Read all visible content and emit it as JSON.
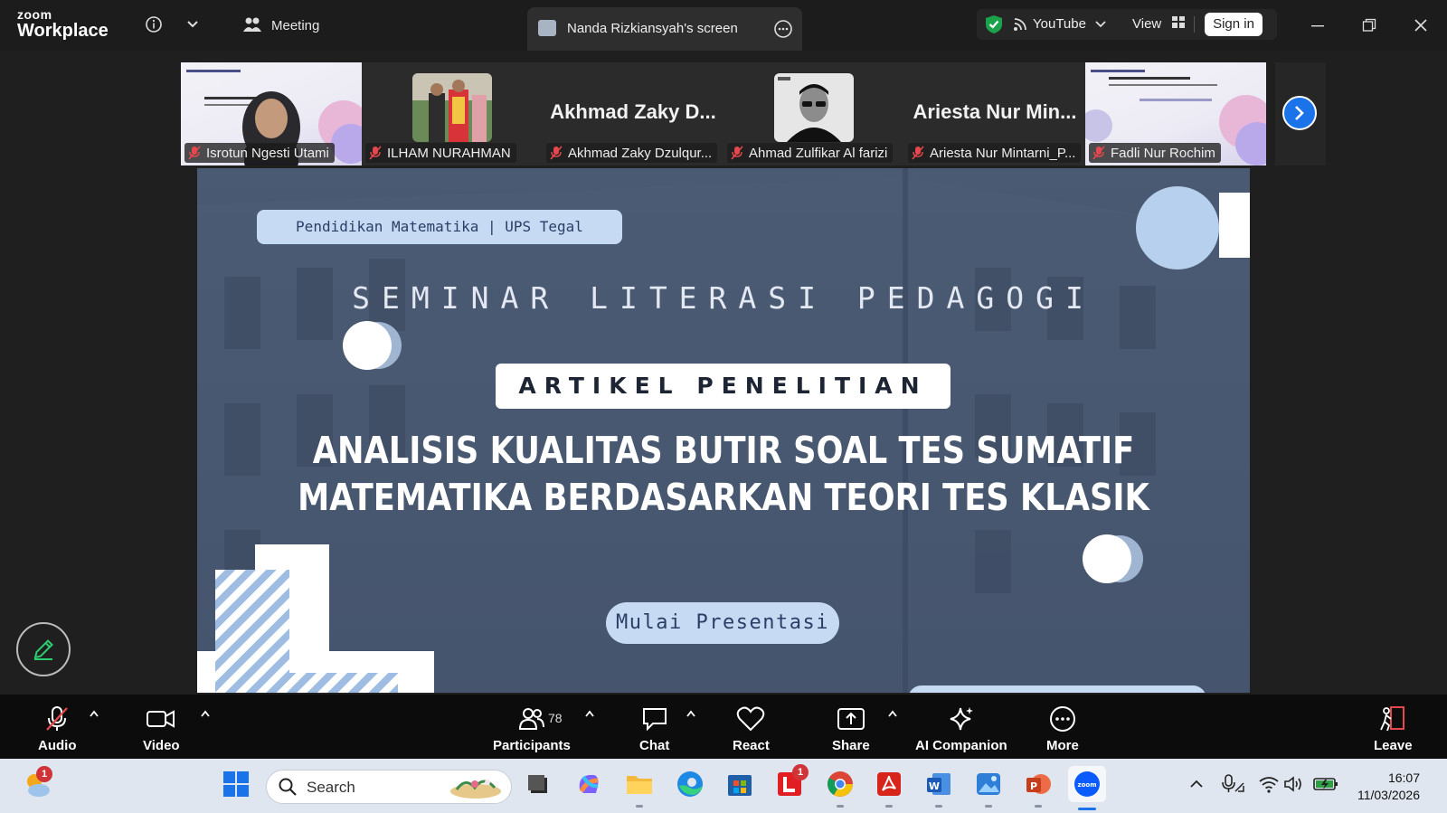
{
  "titlebar": {
    "logo_top": "zoom",
    "logo_bottom": "Workplace",
    "meeting_label": "Meeting",
    "screen_share_label": "Nanda Rizkiansyah's screen",
    "youtube_label": "YouTube",
    "view_label": "View",
    "signin_label": "Sign in"
  },
  "gallery": {
    "tiles": [
      {
        "name": "Isrotun Ngesti Utami",
        "type": "slide-video"
      },
      {
        "name": "ILHAM NURAHMAN",
        "type": "photo"
      },
      {
        "name": "Akhmad Zaky Dzulqur...",
        "bigname": "Akhmad Zaky D...",
        "type": "name-only"
      },
      {
        "name": "Ahmad Zulfikar Al farizi",
        "type": "photo"
      },
      {
        "name": "Ariesta Nur Mintarni_P...",
        "bigname": "Ariesta Nur Min...",
        "type": "name-only"
      },
      {
        "name": "Fadli Nur Rochim",
        "type": "slide"
      }
    ]
  },
  "slide": {
    "badge": "Pendidikan Matematika | UPS Tegal",
    "heading": "SEMINAR LITERASI PEDAGOGI",
    "label": "ARTIKEL PENELITIAN",
    "title_line1": "ANALISIS KUALITAS BUTIR SOAL TES SUMATIF",
    "title_line2": "MATEMATIKA BERDASARKAN TEORI TES KLASIK",
    "button": "Mulai Presentasi"
  },
  "controls": {
    "audio": "Audio",
    "video": "Video",
    "participants": "Participants",
    "participants_count": "78",
    "chat": "Chat",
    "react": "React",
    "share": "Share",
    "ai_companion": "AI Companion",
    "more": "More",
    "leave": "Leave"
  },
  "taskbar": {
    "search_placeholder": "Search",
    "weather_badge": "1",
    "lms_badge": "1",
    "time": "16:07",
    "date": "11/03/2026"
  },
  "colors": {
    "accent": "#1a73e8",
    "muted_red": "#e5484d",
    "slide_bg": "#44536c",
    "pill": "#c6daf4"
  }
}
